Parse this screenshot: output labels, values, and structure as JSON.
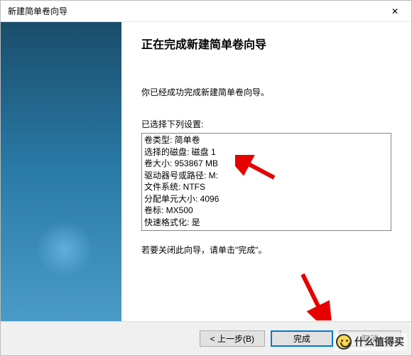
{
  "title": "新建简单卷向导",
  "close_glyph": "✕",
  "heading": "正在完成新建简单卷向导",
  "intro": "你已经成功完成新建简单卷向导。",
  "settings_label": "已选择下列设置:",
  "settings_lines": [
    "卷类型: 简单卷",
    "选择的磁盘: 磁盘 1",
    "卷大小: 953867 MB",
    "驱动器号或路径: M:",
    "文件系统: NTFS",
    "分配单元大小: 4096",
    "卷标: MX500",
    "快速格式化: 是"
  ],
  "close_hint": "若要关闭此向导，请单击\"完成\"。",
  "buttons": {
    "back": "< 上一步(B)",
    "finish": "完成",
    "cancel": "取消"
  },
  "watermark": "什么值得买"
}
